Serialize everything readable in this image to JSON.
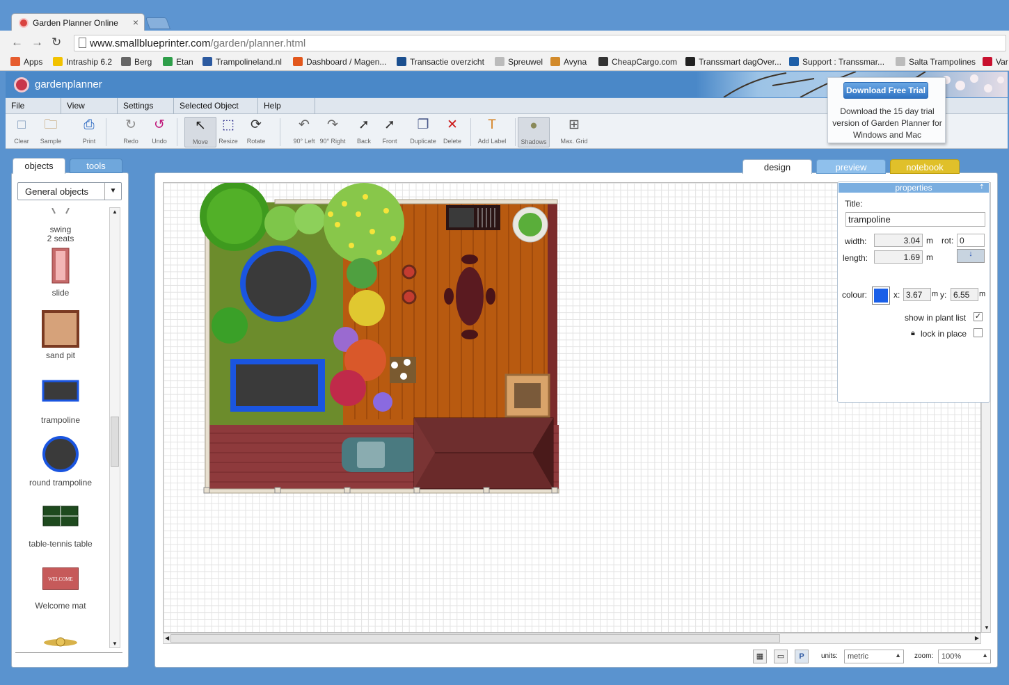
{
  "browser": {
    "tab_title": "Garden Planner Online",
    "tab_close": "×",
    "url_host": "www.smallblueprinter.com",
    "url_path": "/garden/planner.html",
    "back_icon": "back-arrow-icon",
    "forward_icon": "forward-arrow-icon",
    "reload_icon": "reload-icon",
    "bookmarks": [
      {
        "label": "Apps",
        "color": "#e65c2e"
      },
      {
        "label": "Intraship 6.2",
        "color": "#f2c200"
      },
      {
        "label": "Berg",
        "color": "#666666"
      },
      {
        "label": "Etan",
        "color": "#2e9e4a"
      },
      {
        "label": "Trampolineland.nl",
        "color": "#2c5aa0"
      },
      {
        "label": "Dashboard / Magen...",
        "color": "#e2571c"
      },
      {
        "label": "Transactie overzicht",
        "color": "#1b4f8f"
      },
      {
        "label": "Spreuwel",
        "color": "#bbbbbb"
      },
      {
        "label": "Avyna",
        "color": "#d28a2a"
      },
      {
        "label": "CheapCargo.com",
        "color": "#333333"
      },
      {
        "label": "Transsmart dagOver...",
        "color": "#222222"
      },
      {
        "label": "Support : Transsmar...",
        "color": "#1e5fa8"
      },
      {
        "label": "Salta Trampolines",
        "color": "#bbbbbb"
      },
      {
        "label": "Var",
        "color": "#c8102e"
      }
    ]
  },
  "app": {
    "brand": "gardenplanner",
    "menus": [
      "File",
      "View",
      "Settings",
      "Selected Object",
      "Help"
    ],
    "tools": [
      {
        "label": "Clear",
        "icon": "□"
      },
      {
        "label": "Sample",
        "icon": "🗀"
      },
      {
        "label": "Print",
        "icon": "⎙"
      },
      {
        "label": "Redo",
        "icon": "↻"
      },
      {
        "label": "Undo",
        "icon": "↺"
      },
      {
        "label": "Move",
        "icon": "↖"
      },
      {
        "label": "Resize",
        "icon": "⬚"
      },
      {
        "label": "Rotate",
        "icon": "⟳"
      },
      {
        "label": "90° Left",
        "icon": "↶"
      },
      {
        "label": "90° Right",
        "icon": "↷"
      },
      {
        "label": "Back",
        "icon": "➚"
      },
      {
        "label": "Front",
        "icon": "➚"
      },
      {
        "label": "Duplicate",
        "icon": "❐"
      },
      {
        "label": "Delete",
        "icon": "✕"
      },
      {
        "label": "Add Label",
        "icon": "T"
      },
      {
        "label": "Shadows",
        "icon": "●"
      },
      {
        "label": "Max. Grid",
        "icon": "⊞"
      }
    ],
    "trial": {
      "button": "Download Free Trial",
      "text": "Download the 15 day trial version of Garden Planner for Windows and Mac"
    }
  },
  "left_panel": {
    "tab_objects": "objects",
    "tab_tools": "tools",
    "category": "General objects",
    "items": [
      "swing\n2 seats",
      "slide",
      "sand pit",
      "trampoline",
      "round trampoline",
      "table-tennis table",
      "Welcome mat"
    ],
    "welcome_text": "WELCOME"
  },
  "canvas": {
    "tabs": [
      "design",
      "preview",
      "notebook"
    ],
    "tab_colors": [
      "#ffffff",
      "#8fc0ec",
      "#e0c02a"
    ]
  },
  "properties": {
    "header": "properties",
    "title_label": "Title:",
    "title_value": "trampoline",
    "width_label": "width:",
    "width_value": "3.04",
    "length_label": "length:",
    "length_value": "1.69",
    "unit": "m",
    "rot_label": "rot:",
    "rot_value": "0",
    "colour_label": "colour:",
    "colour_value": "#1a5fe8",
    "x_label": "x:",
    "x_value": "3.67",
    "y_label": "y:",
    "y_value": "6.55",
    "show_in_plant_list": "show in plant list",
    "show_checked": "✓",
    "lock_in_place": "lock in place"
  },
  "status": {
    "units_label": "units:",
    "units_value": "metric",
    "zoom_label": "zoom:",
    "zoom_value": "100%",
    "p_button": "P"
  }
}
